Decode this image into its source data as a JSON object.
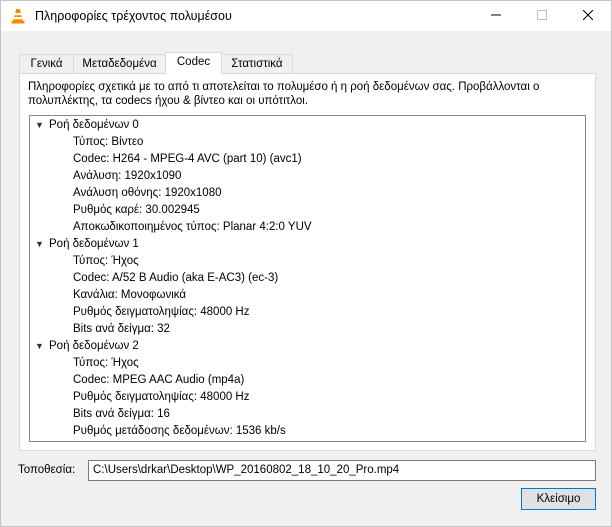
{
  "window": {
    "title": "Πληροφορίες τρέχοντος πολυμέσου",
    "app_icon": "vlc-cone-icon",
    "controls": [
      "minimize-icon",
      "maximize-icon",
      "close-icon"
    ]
  },
  "tabs": [
    {
      "label": "Γενικά",
      "active": false
    },
    {
      "label": "Μεταδεδομένα",
      "active": false
    },
    {
      "label": "Codec",
      "active": true
    },
    {
      "label": "Στατιστικά",
      "active": false
    }
  ],
  "codec": {
    "description": "Πληροφορίες σχετικά με το από τι αποτελείται το πολυμέσο ή η ροή δεδομένων σας. Προβάλλονται ο πολυπλέκτης, τα codecs ήχου & βίντεο και οι υπότιτλοι.",
    "streams": [
      {
        "label": "Ροή δεδομένων 0",
        "items": [
          "Τύπος: Βίντεο",
          "Codec: H264 - MPEG-4 AVC (part 10) (avc1)",
          "Ανάλυση: 1920x1090",
          "Ανάλυση οθόνης: 1920x1080",
          "Ρυθμός καρέ: 30.002945",
          "Αποκωδικοποιημένος τύπος: Planar 4:2:0 YUV"
        ]
      },
      {
        "label": "Ροή δεδομένων 1",
        "items": [
          "Τύπος: Ήχος",
          "Codec: A/52 B Audio (aka E-AC3) (ec-3)",
          "Κανάλια: Μονοφωνικά",
          "Ρυθμός δειγματοληψίας: 48000 Hz",
          "Bits ανά δείγμα: 32"
        ]
      },
      {
        "label": "Ροή δεδομένων 2",
        "items": [
          "Τύπος: Ήχος",
          "Codec: MPEG AAC Audio (mp4a)",
          "Ρυθμός δειγματοληψίας: 48000 Hz",
          "Bits ανά δείγμα: 16",
          "Ρυθμός μετάδοσης δεδομένων: 1536 kb/s"
        ]
      }
    ]
  },
  "location": {
    "label": "Τοποθεσία:",
    "value": "C:\\Users\\drkar\\Desktop\\WP_20160802_18_10_20_Pro.mp4"
  },
  "buttons": {
    "close_label": "Κλείσιμο"
  },
  "colors": {
    "accent": "#0078d7",
    "vlc_orange": "#f48b00"
  }
}
